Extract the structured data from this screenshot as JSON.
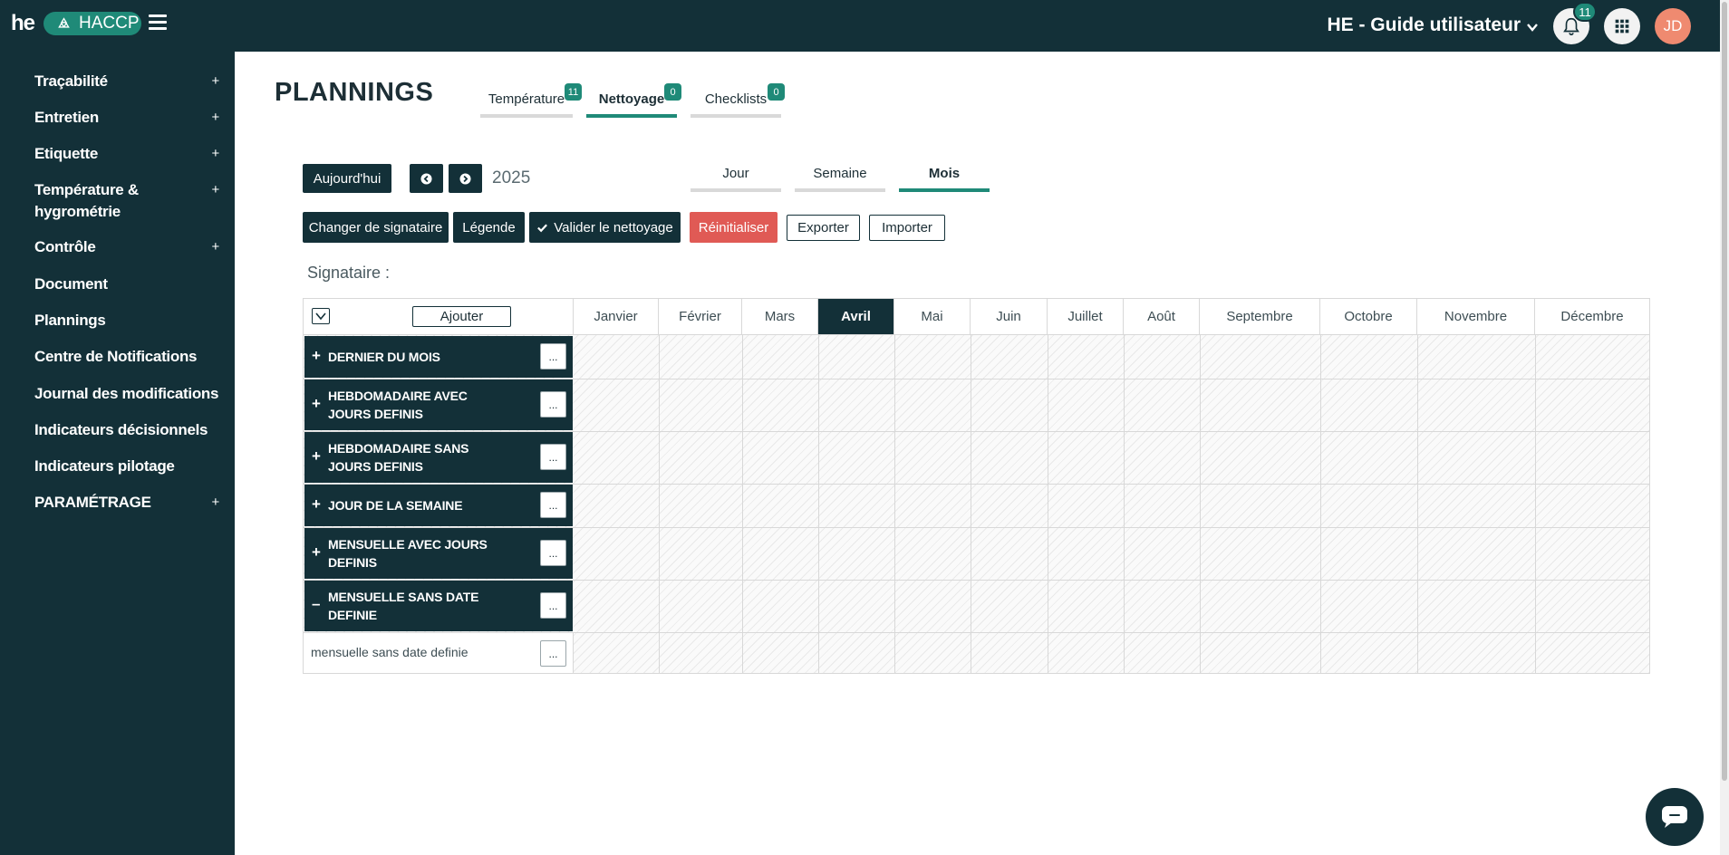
{
  "topbar": {
    "logo_text": "he",
    "app_badge": "HACCP",
    "site_name": "HE - Guide utilisateur",
    "notifications_count": "11",
    "avatar_initials": "JD"
  },
  "sidebar": {
    "items": [
      {
        "label": "Traçabilité",
        "expandable": "+"
      },
      {
        "label": "Entretien",
        "expandable": "+"
      },
      {
        "label": "Etiquette",
        "expandable": "+"
      },
      {
        "label": "Température & hygrométrie",
        "expandable": "+"
      },
      {
        "label": "Contrôle",
        "expandable": "+"
      },
      {
        "label": "Document"
      },
      {
        "label": "Plannings"
      },
      {
        "label": "Centre de Notifications"
      },
      {
        "label": "Journal des modifications"
      },
      {
        "label": "Indicateurs décisionnels"
      },
      {
        "label": "Indicateurs pilotage"
      },
      {
        "label": "PARAMÉTRAGE",
        "expandable": "+"
      }
    ]
  },
  "main": {
    "title": "PLANNINGS",
    "tabs": [
      {
        "label": "Température",
        "badge": "11"
      },
      {
        "label": "Nettoyage",
        "badge": "0",
        "active": true
      },
      {
        "label": "Checklists",
        "badge": "0"
      }
    ],
    "today_button": "Aujourd'hui",
    "year": "2025",
    "view_tabs": [
      {
        "label": "Jour"
      },
      {
        "label": "Semaine"
      },
      {
        "label": "Mois",
        "active": true
      }
    ],
    "actions": {
      "change_signer": "Changer de signataire",
      "legend": "Légende",
      "validate": "Valider le nettoyage",
      "reset": "Réinitialiser",
      "export": "Exporter",
      "import": "Importer"
    },
    "signataire_label": "Signataire :",
    "grid": {
      "add_button": "Ajouter",
      "months": [
        "Janvier",
        "Février",
        "Mars",
        "Avril",
        "Mai",
        "Juin",
        "Juillet",
        "Août",
        "Septembre",
        "Octobre",
        "Novembre",
        "Décembre"
      ],
      "current_month": "Avril",
      "groups": [
        {
          "label": "DERNIER DU MOIS",
          "sign": "+"
        },
        {
          "label": "HEBDOMADAIRE AVEC JOURS DEFINIS",
          "sign": "+"
        },
        {
          "label": "HEBDOMADAIRE SANS JOURS DEFINIS",
          "sign": "+"
        },
        {
          "label": "JOUR DE LA SEMAINE",
          "sign": "+"
        },
        {
          "label": "MENSUELLE AVEC JOURS DEFINIS",
          "sign": "+"
        },
        {
          "label": "MENSUELLE SANS DATE DEFINIE",
          "sign": "–"
        }
      ],
      "sub_rows": [
        {
          "label": "mensuelle sans date definie"
        }
      ],
      "dots_label": "..."
    }
  },
  "colors": {
    "primary_dark": "#133038",
    "accent_green": "#1f8a78",
    "danger_red": "#e05a55",
    "avatar_orange": "#ef8a70"
  }
}
